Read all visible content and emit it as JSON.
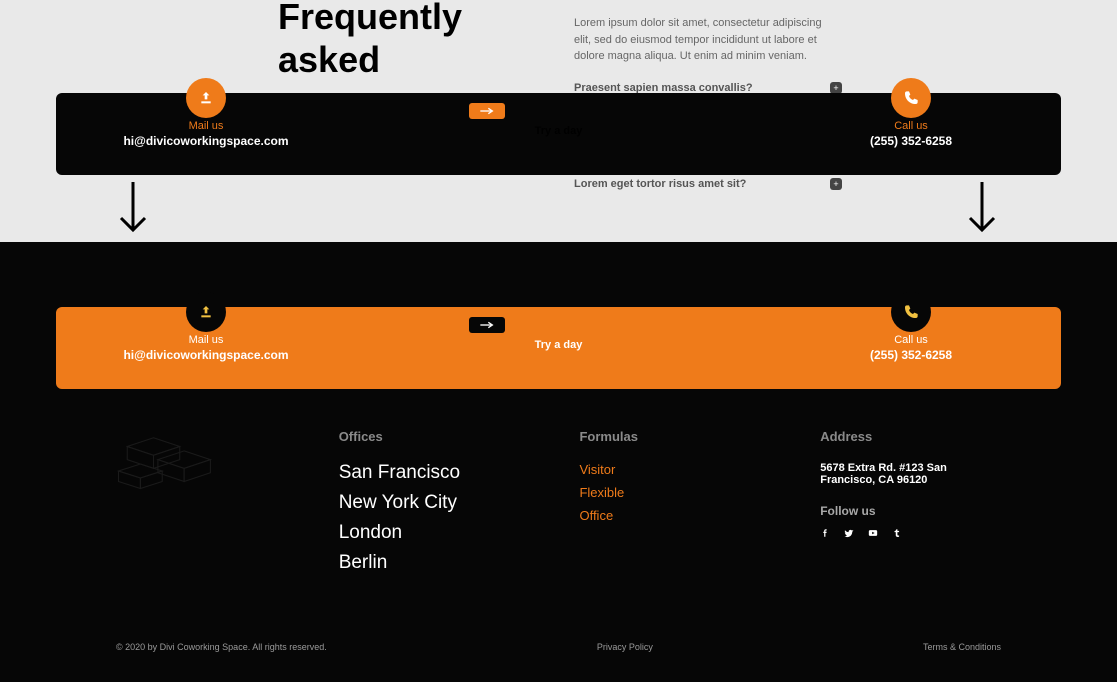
{
  "faq": {
    "title_line1": "Frequently",
    "title_line2": "asked",
    "lorem": "Lorem ipsum dolor sit amet, consectetur adipiscing elit, sed do eiusmod tempor incididunt ut labore et dolore magna aliqua. Ut enim ad minim veniam.",
    "item1": "Praesent sapien massa convallis?",
    "item2": "Lorem eget tortor risus amet sit?"
  },
  "cta": {
    "mail_label": "Mail us",
    "mail_value": "hi@divicoworkingspace.com",
    "try_label": "Try a day",
    "call_label": "Call us",
    "call_value": "(255) 352-6258"
  },
  "footer": {
    "offices_heading": "Offices",
    "offices": [
      "San Francisco",
      "New York City",
      "London",
      "Berlin"
    ],
    "formulas_heading": "Formulas",
    "formulas": [
      "Visitor",
      "Flexible",
      "Office"
    ],
    "address_heading": "Address",
    "address": "5678 Extra Rd. #123 San Francisco, CA 96120",
    "follow_heading": "Follow us"
  },
  "copyright": {
    "text": "© 2020 by Divi Coworking Space. All rights reserved.",
    "privacy": "Privacy Policy",
    "terms": "Terms & Conditions"
  }
}
